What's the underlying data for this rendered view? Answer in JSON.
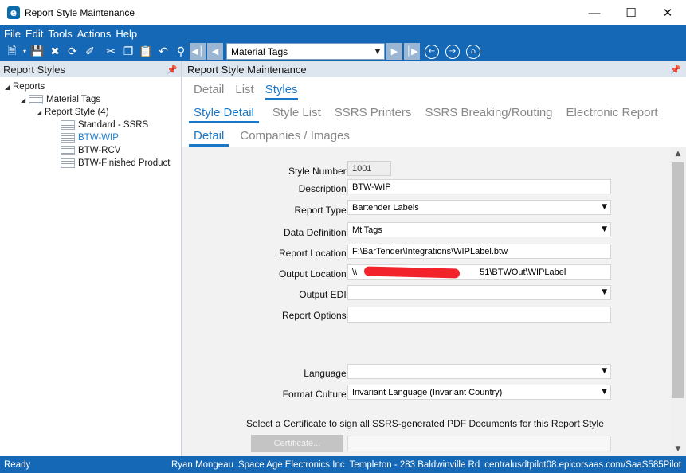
{
  "window": {
    "title": "Report Style Maintenance",
    "app_icon": "e"
  },
  "menu": [
    "File",
    "Edit",
    "Tools",
    "Actions",
    "Help"
  ],
  "toolbar": {
    "combo_value": "Material Tags",
    "icons": [
      "new-icon",
      "save-icon",
      "delete-icon",
      "refresh-icon",
      "clear-icon",
      "cut-icon",
      "copy-icon",
      "paste-icon",
      "undo-icon",
      "search-binoculars-icon",
      "first-icon",
      "prev-icon",
      "next-icon",
      "last-icon",
      "back-icon",
      "forward-icon",
      "home-icon"
    ]
  },
  "left_panel": {
    "title": "Report Styles",
    "tree": {
      "root": "Reports",
      "level1": "Material Tags",
      "level2": "Report Style (4)",
      "items": [
        "Standard - SSRS",
        "BTW-WIP",
        "BTW-RCV",
        "BTW-Finished Product"
      ],
      "selected": "BTW-WIP"
    }
  },
  "right_panel": {
    "title": "Report Style Maintenance",
    "tabs_row1": [
      "Detail",
      "List",
      "Styles"
    ],
    "tabs_row2": [
      "Style Detail",
      "Style List",
      "SSRS Printers",
      "SSRS Breaking/Routing",
      "Electronic Report"
    ],
    "tabs_row3": [
      "Detail",
      "Companies / Images"
    ]
  },
  "form": {
    "style_number": {
      "label": "Style Number:",
      "value": "1001"
    },
    "description": {
      "label": "Description:",
      "value": "BTW-WIP"
    },
    "report_type": {
      "label": "Report Type:",
      "value": "Bartender Labels"
    },
    "data_definition": {
      "label": "Data Definition:",
      "value": "MtlTags"
    },
    "report_location": {
      "label": "Report Location:",
      "value": "F:\\BarTender\\Integrations\\WIPLabel.btw"
    },
    "output_location": {
      "label": "Output Location:",
      "value_start": "\\\\",
      "value_end": "51\\BTWOut\\WIPLabel"
    },
    "output_edi": {
      "label": "Output EDI:",
      "value": ""
    },
    "report_options": {
      "label": "Report Options:",
      "value": ""
    },
    "language": {
      "label": "Language:",
      "value": ""
    },
    "format_culture": {
      "label": "Format Culture:",
      "value": "Invariant Language (Invariant Country)"
    },
    "certificate_text": "Select a Certificate to sign all SSRS-generated PDF Documents for this Report Style",
    "certificate_button": "Certificate..."
  },
  "status": {
    "left": "Ready",
    "user": "Ryan Mongeau",
    "company": "Space Age Electronics Inc",
    "site": "Templeton - 283 Baldwinville Rd",
    "server": "centralusdtpilot08.epicorsaas.com/SaaS585Pilot"
  },
  "colors": {
    "accent": "#1468b5",
    "tab_active": "#1877c9",
    "redaction": "#f2232b"
  }
}
